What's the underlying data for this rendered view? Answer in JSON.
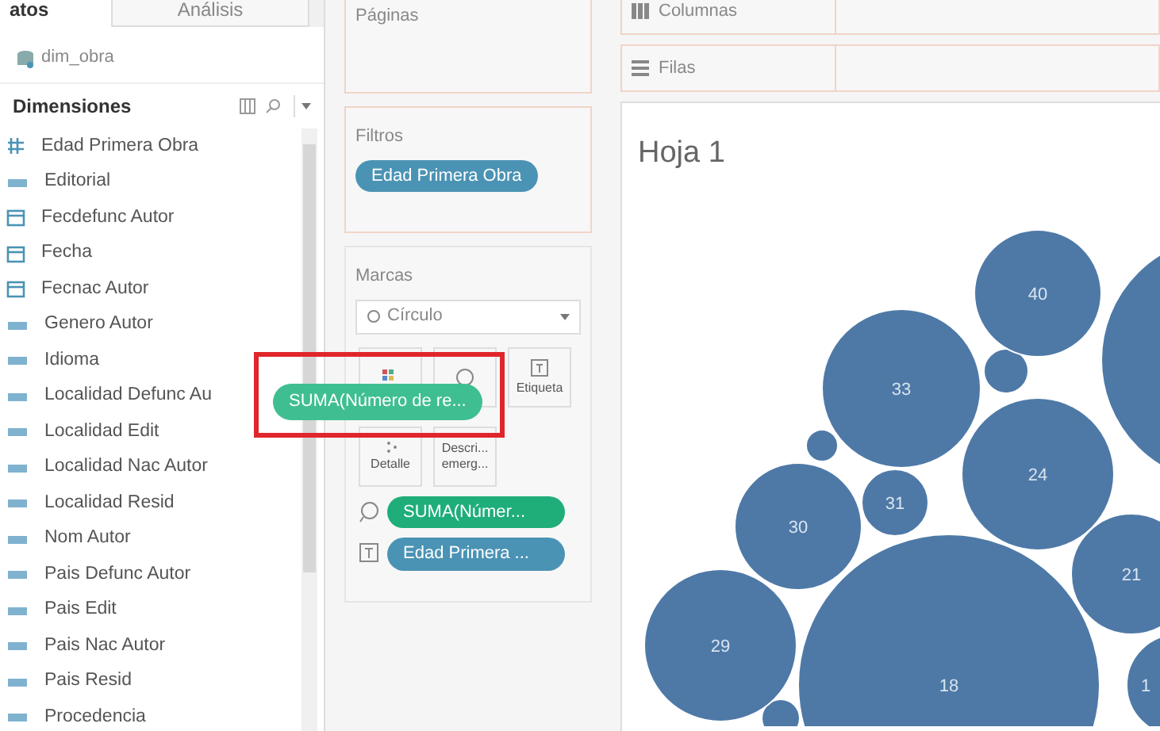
{
  "data_panel": {
    "tabs": [
      {
        "label": "atos",
        "selected": true
      },
      {
        "label": "Análisis",
        "selected": false
      }
    ],
    "data_source": "dim_obra",
    "section_title": "Dimensiones",
    "fields": [
      {
        "kind": "number",
        "label": "Edad Primera Obra"
      },
      {
        "kind": "text",
        "label": "Editorial"
      },
      {
        "kind": "date",
        "label": "Fecdefunc Autor"
      },
      {
        "kind": "date",
        "label": "Fecha"
      },
      {
        "kind": "date",
        "label": "Fecnac Autor"
      },
      {
        "kind": "text",
        "label": "Genero Autor"
      },
      {
        "kind": "text",
        "label": "Idioma"
      },
      {
        "kind": "text",
        "label": "Localidad Defunc Au"
      },
      {
        "kind": "text",
        "label": "Localidad Edit"
      },
      {
        "kind": "text",
        "label": "Localidad Nac Autor"
      },
      {
        "kind": "text",
        "label": "Localidad Resid"
      },
      {
        "kind": "text",
        "label": "Nom Autor"
      },
      {
        "kind": "text",
        "label": "Pais Defunc Autor"
      },
      {
        "kind": "text",
        "label": "Pais Edit"
      },
      {
        "kind": "text",
        "label": "Pais Nac Autor"
      },
      {
        "kind": "text",
        "label": "Pais Resid"
      },
      {
        "kind": "text",
        "label": "Procedencia"
      }
    ]
  },
  "pages_card": {
    "title": "Páginas"
  },
  "filters_card": {
    "title": "Filtros",
    "pills": [
      "Edad Primera Obra"
    ]
  },
  "marks_card": {
    "title": "Marcas",
    "mark_type": "Círculo",
    "buttons": [
      {
        "kind": "color"
      },
      {
        "kind": "size"
      },
      {
        "kind": "label",
        "label": "Etiqueta"
      },
      {
        "kind": "detail",
        "label": "Detalle"
      },
      {
        "kind": "tooltip",
        "label": "Descri...\nemerg..."
      }
    ],
    "pills": [
      {
        "kind": "size",
        "label": "SUMA(Númer...",
        "color": "#1fae7a"
      },
      {
        "kind": "label",
        "label": "Edad Primera ...",
        "color": "#4b93b4"
      }
    ]
  },
  "columns_shelf": {
    "label": "Columnas"
  },
  "rows_shelf": {
    "label": "Filas"
  },
  "sheet": {
    "title": "Hoja 1",
    "bubbles": [
      "40",
      "33",
      "24",
      "31",
      "30",
      "21",
      "29",
      "18",
      "1"
    ]
  },
  "drag_pill": {
    "label": "SUMA(Número de re..."
  }
}
